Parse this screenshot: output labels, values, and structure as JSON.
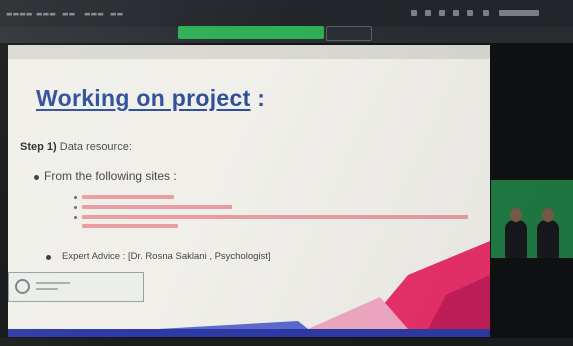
{
  "slide": {
    "title": "Working on project",
    "title_suffix": " :",
    "step_label": "Step 1)",
    "step_text": " Data resource:",
    "bullet_1": "From the following sites :",
    "bullet_2": "Expert Advice : [Dr. Rosna Saklani , Psychologist]"
  },
  "colors": {
    "title": "#2d4e9a",
    "link_text": "#e68e95",
    "share_bar": "#2fbf58",
    "video_background": "#1f7a43",
    "corner_pink": "#e8306a",
    "bottom_band": "#2e3aa6"
  },
  "icons": {
    "webcam_logo": "circle-logo-icon"
  }
}
